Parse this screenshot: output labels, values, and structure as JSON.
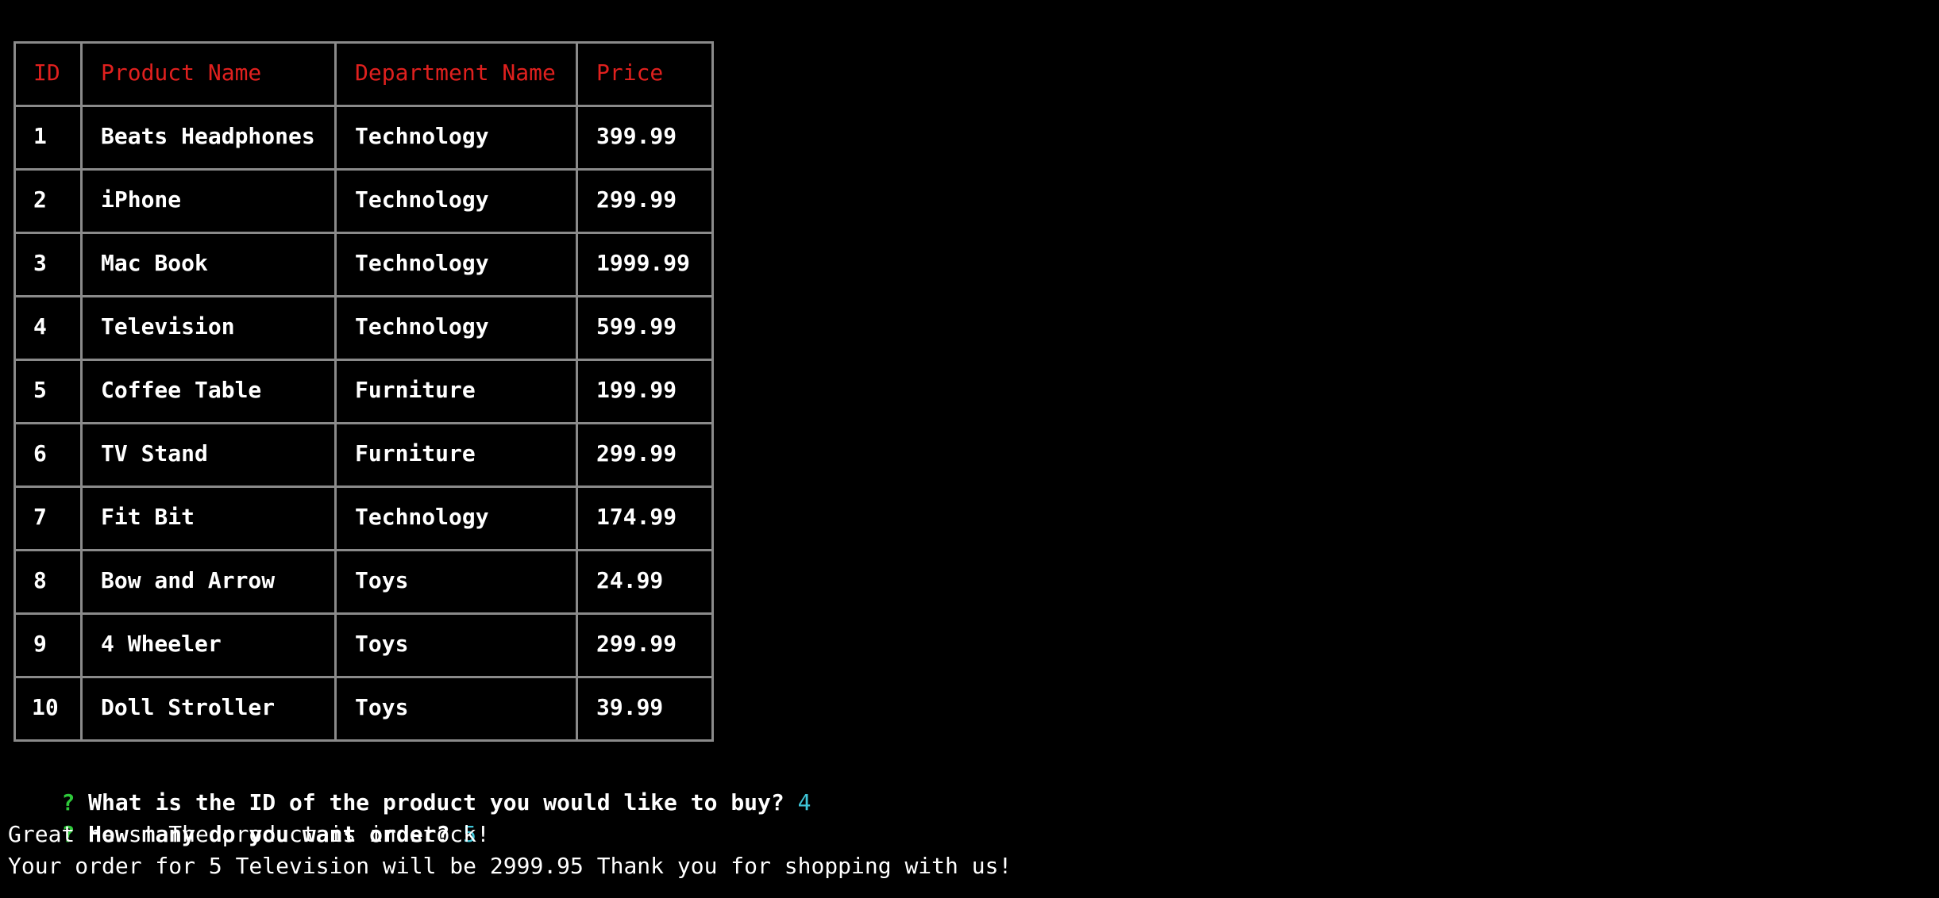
{
  "table": {
    "headers": [
      "ID",
      "Product Name",
      "Department Name",
      "Price"
    ],
    "rows": [
      [
        "1",
        "Beats Headphones",
        "Technology",
        "399.99"
      ],
      [
        "2",
        "iPhone",
        "Technology",
        "299.99"
      ],
      [
        "3",
        "Mac Book",
        "Technology",
        "1999.99"
      ],
      [
        "4",
        "Television",
        "Technology",
        "599.99"
      ],
      [
        "5",
        "Coffee Table",
        "Furniture",
        "199.99"
      ],
      [
        "6",
        "TV Stand",
        "Furniture",
        "299.99"
      ],
      [
        "7",
        "Fit Bit",
        "Technology",
        "174.99"
      ],
      [
        "8",
        "Bow and Arrow",
        "Toys",
        "24.99"
      ],
      [
        "9",
        "4 Wheeler",
        "Toys",
        "299.99"
      ],
      [
        "10",
        "Doll Stroller",
        "Toys",
        "39.99"
      ]
    ]
  },
  "prompts": [
    {
      "mark": "?",
      "question": "What is the ID of the product you would like to buy?",
      "answer": "4"
    },
    {
      "mark": "?",
      "question": "How many do you want order?",
      "answer": "5"
    }
  ],
  "output": [
    "Great news! The product is in stock!",
    "Your order for 5 Television will be 2999.95 Thank you for shopping with us!"
  ],
  "colors": {
    "background": "#000000",
    "header_text": "#e0201e",
    "prompt_mark": "#2ec93a",
    "answer": "#3fc6d8",
    "border": "#8a8a8a"
  }
}
